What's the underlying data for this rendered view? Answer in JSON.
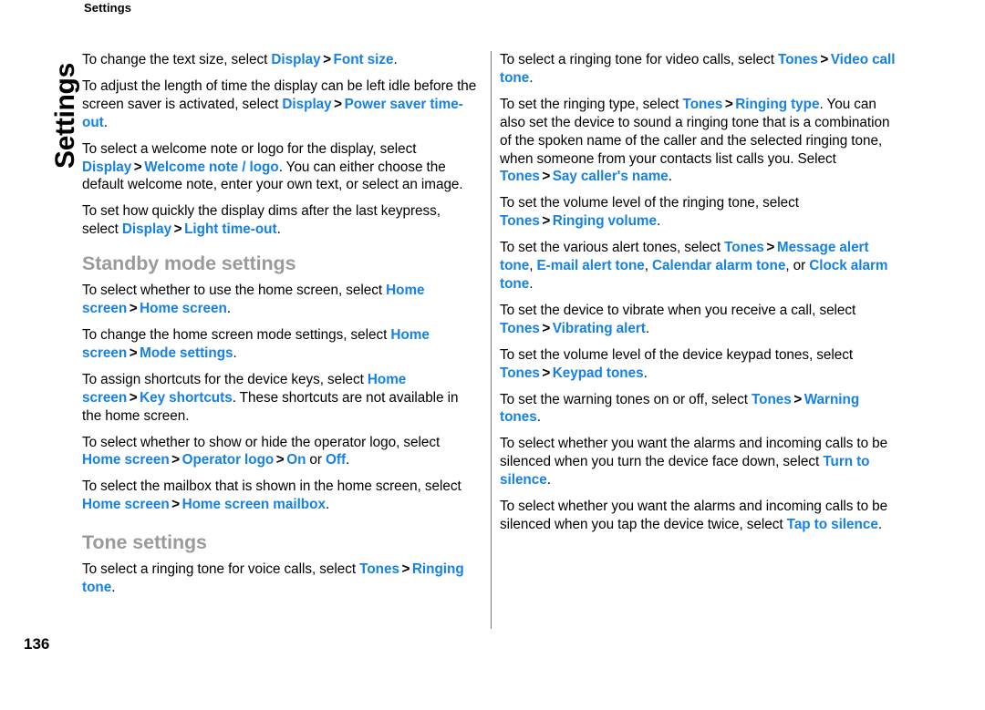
{
  "page": {
    "running_header": "Settings",
    "chapter_tab": "Settings",
    "folio": "136",
    "accent_color": "#1581E4",
    "heading_color": "#9a9a9a",
    "divider_color": "#7a7a7a"
  },
  "separator": ">",
  "left_column": {
    "p1": {
      "t1": "To change the text size, select ",
      "ui1": "Display",
      "ui2": "Font size",
      "t2": "."
    },
    "p2": {
      "t1": "To adjust the length of time the display can be left idle before the screen saver is activated, select ",
      "ui1": "Display",
      "ui2": "Power saver time-out",
      "t2": "."
    },
    "p3": {
      "t1": "To select a welcome note or logo for the display, select ",
      "ui1": "Display",
      "ui2": "Welcome note / logo",
      "t2": ". You can either choose the default welcome note, enter your own text, or select an image."
    },
    "p4": {
      "t1": "To set how quickly the display dims after the last keypress, select ",
      "ui1": "Display",
      "ui2": "Light time-out",
      "t2": "."
    },
    "heading1": "Standby mode settings",
    "p5": {
      "t1": "To select whether to use the home screen, select ",
      "ui1": "Home screen",
      "ui2": "Home screen",
      "t2": "."
    },
    "p6": {
      "t1": "To change the home screen mode settings, select ",
      "ui1": "Home screen",
      "ui2": "Mode settings",
      "t2": "."
    },
    "p7": {
      "t1": "To assign shortcuts for the device keys, select ",
      "ui1": "Home screen",
      "ui2": "Key shortcuts",
      "t2": ". These shortcuts are not available in the home screen."
    },
    "p8": {
      "t1": "To select whether to show or hide the operator logo, select ",
      "ui1": "Home screen",
      "ui2": "Operator logo",
      "ui3": "On",
      "t2": " or ",
      "ui4": "Off",
      "t3": "."
    },
    "p9": {
      "t1": "To select the mailbox that is shown in the home screen, select ",
      "ui1": "Home screen",
      "ui2": "Home screen mailbox",
      "t2": "."
    },
    "heading2": "Tone settings",
    "p10": {
      "t1": "To select a ringing tone for voice calls, select ",
      "ui1": "Tones",
      "ui2": "Ringing tone",
      "t2": "."
    }
  },
  "right_column": {
    "p1": {
      "t1": "To select a ringing tone for video calls, select ",
      "ui1": "Tones",
      "ui2": "Video call tone",
      "t2": "."
    },
    "p2": {
      "t1": "To set the ringing type, select ",
      "ui1": "Tones",
      "ui2": "Ringing type",
      "t2": ". You can also set the device to sound a ringing tone that is a combination of the spoken name of the caller and the selected ringing tone, when someone from your contacts list calls you. Select ",
      "ui3": "Tones",
      "ui4": "Say caller's name",
      "t3": "."
    },
    "p3": {
      "t1": "To set the volume level of the ringing tone, select ",
      "ui1": "Tones",
      "ui2": "Ringing volume",
      "t2": "."
    },
    "p4": {
      "t1": "To set the various alert tones, select ",
      "ui1": "Tones",
      "ui2": "Message alert tone",
      "t2": ", ",
      "ui3": "E-mail alert tone",
      "t3": ", ",
      "ui4": "Calendar alarm tone",
      "t4": ", or ",
      "ui5": "Clock alarm tone",
      "t5": "."
    },
    "p5": {
      "t1": "To set the device to vibrate when you receive a call, select ",
      "ui1": "Tones",
      "ui2": "Vibrating alert",
      "t2": "."
    },
    "p6": {
      "t1": "To set the volume level of the device keypad tones, select ",
      "ui1": "Tones",
      "ui2": "Keypad tones",
      "t2": "."
    },
    "p7": {
      "t1": "To set the warning tones on or off, select ",
      "ui1": "Tones",
      "ui2": "Warning tones",
      "t2": "."
    },
    "p8": {
      "t1": "To select whether you want the alarms and incoming calls to be silenced when you turn the device face down, select ",
      "ui1": "Turn to silence",
      "t2": "."
    },
    "p9": {
      "t1": "To select whether you want the alarms and incoming calls to be silenced when you tap the device twice, select ",
      "ui1": "Tap to silence",
      "t2": "."
    }
  }
}
